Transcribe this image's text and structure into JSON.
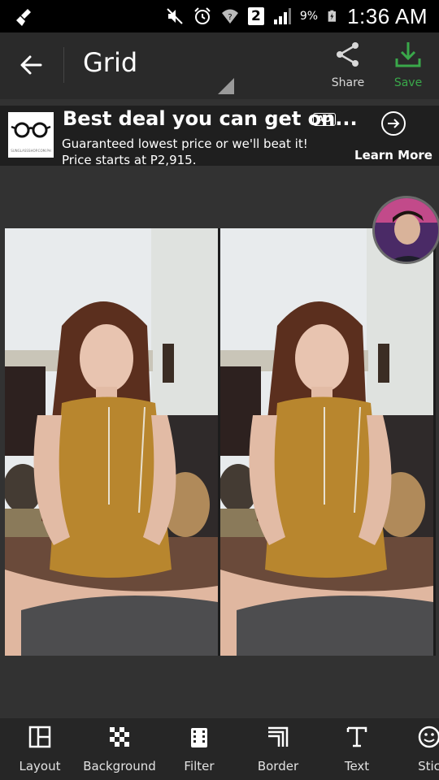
{
  "status_bar": {
    "battery_percent": "9%",
    "sim_slot": "2",
    "time": "1:36 AM"
  },
  "action_bar": {
    "title": "Grid",
    "share_label": "Share",
    "save_label": "Save",
    "save_color": "#3aa84a"
  },
  "ad": {
    "title": "Best deal you can get on...",
    "badge": "AD",
    "line1": "Guaranteed lowest price or we'll beat it!",
    "line2": "Price starts at P2,915.",
    "cta": "Learn More",
    "logo_url_text": "SUNGLASSSHOP.COM.PH"
  },
  "toolbar": {
    "items": [
      {
        "label": "Layout",
        "icon": "layout-icon"
      },
      {
        "label": "Background",
        "icon": "background-icon"
      },
      {
        "label": "Filter",
        "icon": "filter-icon"
      },
      {
        "label": "Border",
        "icon": "border-icon"
      },
      {
        "label": "Text",
        "icon": "text-icon"
      },
      {
        "label": "Stic",
        "icon": "sticker-icon"
      }
    ]
  },
  "colors": {
    "background": "#323232",
    "action_bar": "#2a2a2a",
    "ad_bg": "#1f1f1f",
    "accent_green": "#3aa84a"
  }
}
